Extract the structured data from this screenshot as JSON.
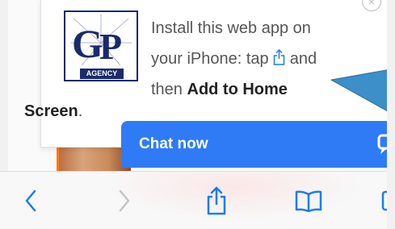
{
  "popup": {
    "logo": {
      "letters": "GP",
      "word": "AGENCY"
    },
    "install_line1": "Install this web app on",
    "install_line2_prefix": "your iPhone: tap",
    "install_line2_suffix": "and",
    "install_line3_prefix": "then",
    "install_line3_bold": "Add to Home",
    "install_line4_bold": "Screen",
    "install_line4_end": "."
  },
  "chat": {
    "label": "Chat now"
  },
  "toolbar": {
    "icons": [
      "back-chevron-icon",
      "forward-chevron-icon",
      "share-icon",
      "bookmarks-icon",
      "tabs-icon"
    ]
  },
  "colors": {
    "accent": "#2f7bf5",
    "ios_blue": "#1a7cf5",
    "logo_navy": "#1a2a6c",
    "callout": "#3c8fc8"
  }
}
